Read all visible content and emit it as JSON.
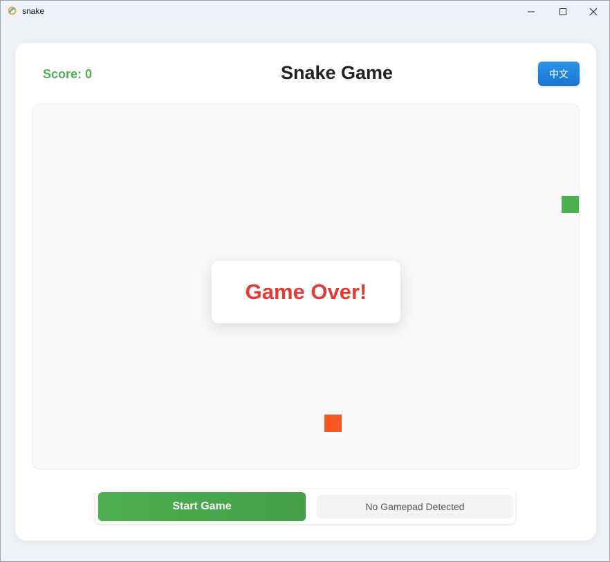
{
  "window": {
    "title": "snake"
  },
  "game": {
    "score_label": "Score: 0",
    "title": "Snake Game",
    "language_button": "中文",
    "overlay_message": "Game Over!",
    "start_button": "Start Game",
    "gamepad_status": "No Gamepad Detected"
  },
  "colors": {
    "score": "#4caf50",
    "snake": "#4caf50",
    "food": "#ff5722",
    "game_over": "#e53935",
    "language_button": "#1976d2",
    "start_button": "#4caf50"
  },
  "icons": {
    "app": "app-icon",
    "minimize": "minimize-icon",
    "maximize": "maximize-icon",
    "close": "close-icon"
  }
}
